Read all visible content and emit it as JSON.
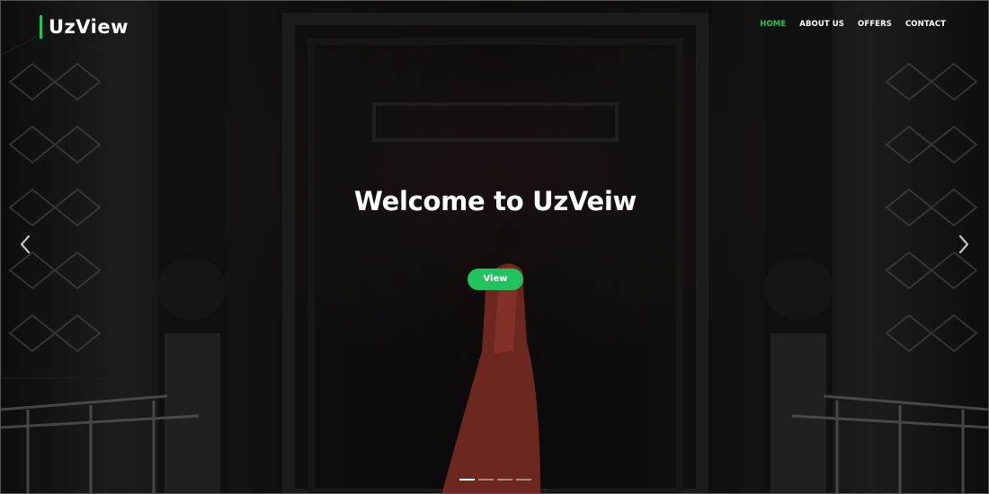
{
  "brand": {
    "name": "UzView",
    "accent_color": "#21c35f"
  },
  "nav": {
    "items": [
      {
        "label": "HOME",
        "active": true
      },
      {
        "label": "ABOUT US",
        "active": false
      },
      {
        "label": "OFFERS",
        "active": false
      },
      {
        "label": "CONTACT",
        "active": false
      }
    ]
  },
  "hero": {
    "headline": "Welcome to UzVeiw",
    "button_label": "View",
    "prev_icon": "chevron-left-icon",
    "next_icon": "chevron-right-icon",
    "slide_count": 4,
    "active_slide": 1,
    "background_image": "dark ornate doorway with woman in red dress"
  }
}
